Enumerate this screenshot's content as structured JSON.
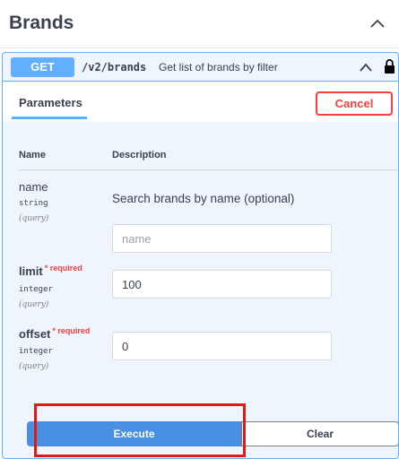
{
  "section": {
    "title": "Brands"
  },
  "operation": {
    "method": "GET",
    "path": "/v2/brands",
    "summary": "Get list of brands by filter"
  },
  "tabs": {
    "parameters": "Parameters",
    "cancel": "Cancel"
  },
  "columns": {
    "name": "Name",
    "description": "Description"
  },
  "params": [
    {
      "name": "name",
      "required": false,
      "required_text": "",
      "type": "string",
      "in": "(query)",
      "description": "Search brands by name (optional)",
      "value": "",
      "placeholder": "name"
    },
    {
      "name": "limit",
      "required": true,
      "required_text": "* required",
      "type": "integer",
      "in": "(query)",
      "description": "",
      "value": "100",
      "placeholder": ""
    },
    {
      "name": "offset",
      "required": true,
      "required_text": "* required",
      "type": "integer",
      "in": "(query)",
      "description": "",
      "value": "0",
      "placeholder": ""
    }
  ],
  "actions": {
    "execute": "Execute",
    "clear": "Clear"
  },
  "colors": {
    "get_accent": "#61affe",
    "cancel_red": "#f93e3e",
    "execute_blue": "#4990e2",
    "highlight_red": "#e01818"
  },
  "icons": {
    "section_toggle": "chevron-up-icon",
    "op_toggle": "chevron-up-icon",
    "auth": "lock-icon"
  }
}
